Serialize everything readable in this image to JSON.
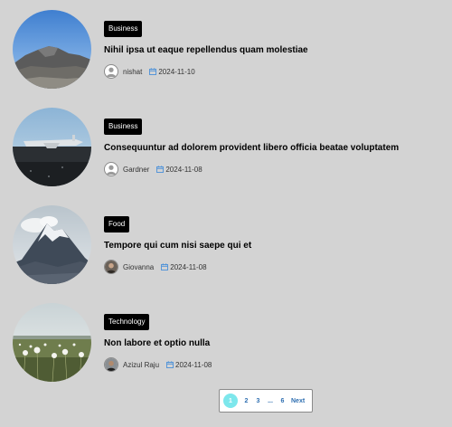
{
  "posts": [
    {
      "category": "Business",
      "title": "Nihil ipsa ut eaque repellendus quam molestiae",
      "author": "nishat",
      "date": "2024-11-10"
    },
    {
      "category": "Business",
      "title": "Consequuntur ad dolorem provident libero officia beatae voluptatem",
      "author": "Gardner",
      "date": "2024-11-08"
    },
    {
      "category": "Food",
      "title": "Tempore qui cum nisi saepe qui et",
      "author": "Giovanna",
      "date": "2024-11-08"
    },
    {
      "category": "Technology",
      "title": "Non labore et optio nulla",
      "author": "Azizul Raju",
      "date": "2024-11-08"
    }
  ],
  "pagination": {
    "current": "1",
    "pages": [
      "2",
      "3"
    ],
    "ellipsis": "...",
    "last": "6",
    "next_label": "Next"
  },
  "colors": {
    "background": "#d3d3d3",
    "tag_bg": "#000000",
    "active_page": "#7de7ec",
    "link": "#2f6fb1",
    "calendar_icon": "#4a90d9"
  }
}
